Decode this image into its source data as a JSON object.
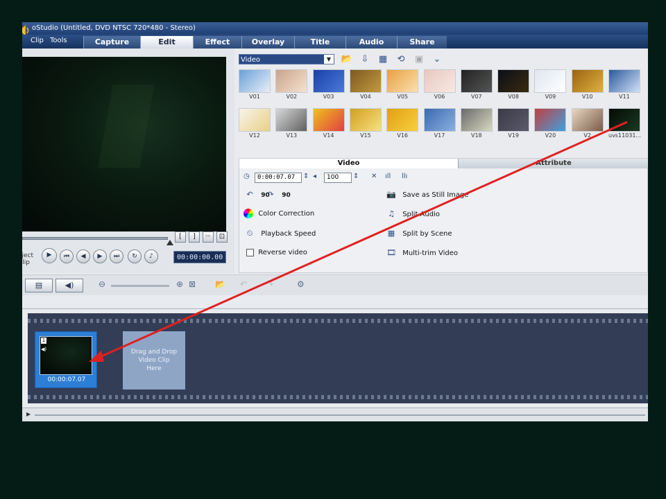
{
  "window": {
    "title": "oStudio (Untitled, DVD NTSC 720*480 - Stereo)"
  },
  "menu": {
    "items": [
      "Clip",
      "Tools"
    ]
  },
  "steps": [
    "Capture",
    "Edit",
    "Effect",
    "Overlay",
    "Title",
    "Audio",
    "Share"
  ],
  "active_step": "Edit",
  "library": {
    "category": "Video",
    "thumbnails": [
      "V01",
      "V02",
      "V03",
      "V04",
      "V05",
      "V06",
      "V07",
      "V08",
      "V09",
      "V10",
      "V11",
      "V12",
      "V13",
      "V14",
      "V15",
      "V16",
      "V17",
      "V18",
      "V19",
      "V20",
      "V2",
      "uvs11031..."
    ]
  },
  "options": {
    "tabs": [
      "Video",
      "Attribute"
    ],
    "duration": "0:00:07.07",
    "volume": "100",
    "rotate_left": "90",
    "rotate_right": "90",
    "color_correction": "Color Correction",
    "playback_speed": "Playback Speed",
    "reverse_video": "Reverse video",
    "save_still": "Save as Still Image",
    "split_audio": "Split Audio",
    "split_by_scene": "Split by Scene",
    "multi_trim": "Multi-trim Video"
  },
  "preview": {
    "timecode": "00:00:00.00",
    "mode_label_1": "oject",
    "mode_label_2": "Clip"
  },
  "timeline": {
    "clip_number": "1",
    "clip_time": "00:00:07.07",
    "drop_text_1": "Drag and Drop",
    "drop_text_2": "Video Clip",
    "drop_text_3": "Here"
  },
  "colors": {
    "accent": "#2c7ed6",
    "arrow": "#e02020",
    "titlebar": "#1f3f73"
  }
}
